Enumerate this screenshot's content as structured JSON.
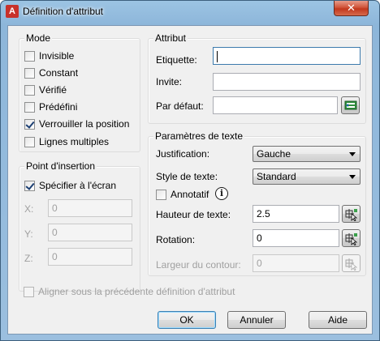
{
  "window": {
    "title": "Définition d'attribut",
    "close_glyph": "✕",
    "app_icon_letter": "A"
  },
  "mode": {
    "title": "Mode",
    "options": [
      {
        "label": "Invisible",
        "checked": false
      },
      {
        "label": "Constant",
        "checked": false
      },
      {
        "label": "Vérifié",
        "checked": false
      },
      {
        "label": "Prédéfini",
        "checked": false
      },
      {
        "label": "Verrouiller la position",
        "checked": true
      },
      {
        "label": "Lignes multiples",
        "checked": false
      }
    ]
  },
  "insertion": {
    "title": "Point d'insertion",
    "specify_label": "Spécifier à l'écran",
    "x_label": "X:",
    "x_value": "0",
    "y_label": "Y:",
    "y_value": "0",
    "z_label": "Z:",
    "z_value": "0"
  },
  "attribute": {
    "title": "Attribut",
    "tag_label": "Etiquette:",
    "tag_value": "",
    "prompt_label": "Invite:",
    "prompt_value": "",
    "default_label": "Par défaut:",
    "default_value": ""
  },
  "text": {
    "title": "Paramètres de texte",
    "justification_label": "Justification:",
    "justification_value": "Gauche",
    "style_label": "Style de texte:",
    "style_value": "Standard",
    "annotative_label": "Annotatif",
    "height_label": "Hauteur de texte:",
    "height_value": "2.5",
    "rotation_label": "Rotation:",
    "rotation_value": "0",
    "width_label": "Largeur du contour:",
    "width_value": "0"
  },
  "align_label": "Aligner sous la précédente définition d'attribut",
  "buttons": {
    "ok": "OK",
    "cancel": "Annuler",
    "help": "Aide"
  },
  "icons": {
    "app": "autocad-app-icon",
    "field": "insert-field-icon",
    "pick": "pick-point-icon",
    "info": "info-icon",
    "close": "close-icon"
  },
  "colors": {
    "close_button": "#c2371c",
    "title_gradient": "#9cc4e3",
    "dialog_bg": "#f0f0f0"
  }
}
